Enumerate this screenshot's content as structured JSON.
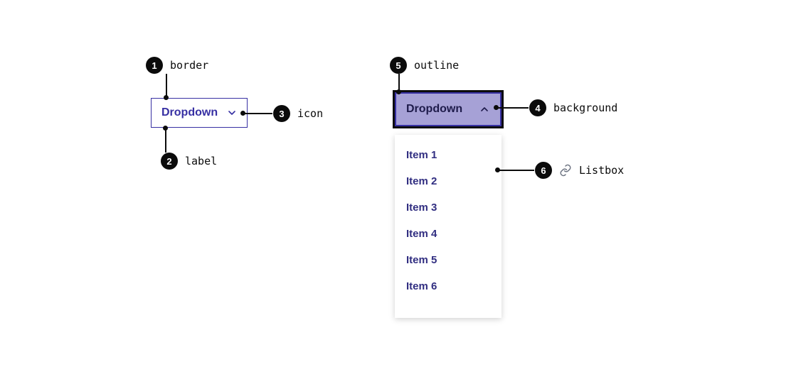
{
  "closed_dropdown": {
    "label": "Dropdown"
  },
  "open_dropdown": {
    "label": "Dropdown",
    "items": [
      "Item 1",
      "Item 2",
      "Item 3",
      "Item 4",
      "Item 5",
      "Item 6"
    ]
  },
  "annotations": {
    "a1": {
      "num": "1",
      "text": "border"
    },
    "a2": {
      "num": "2",
      "text": "label"
    },
    "a3": {
      "num": "3",
      "text": "icon"
    },
    "a4": {
      "num": "4",
      "text": "background"
    },
    "a5": {
      "num": "5",
      "text": "outline"
    },
    "a6": {
      "num": "6",
      "text": "Listbox"
    }
  }
}
